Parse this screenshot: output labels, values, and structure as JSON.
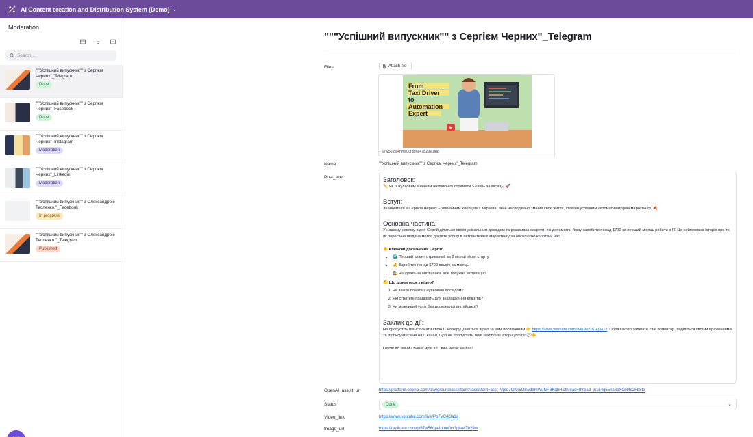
{
  "app": {
    "title": "AI Content creation and Distribution System (Demo)"
  },
  "sidebar": {
    "title": "Moderation",
    "search_placeholder": "Search...",
    "items": [
      {
        "title": "\"\"\"Успішний випускник\"\" з Сергієм Черних\"_Telegram",
        "status": "Done"
      },
      {
        "title": "\"\"\"Успішний випускник\"\" з Сергієм Черних\"_Facebook",
        "status": "Done"
      },
      {
        "title": "\"\"\"Успішний випускник\"\" з Сергієм Черних\"_Instagram",
        "status": "Moderation"
      },
      {
        "title": "\"\"\"Успішний випускник\"\" з Сергієм Черних\"_Linkedin",
        "status": "Moderation"
      },
      {
        "title": "\"\"\"Успішний випускник\"\" з Олександрою Тесленко.\"_Facebook",
        "status": "In progress"
      },
      {
        "title": "\"\"\"Успішний випускник\"\" з Олександрою Тесленко.\"_Telegram",
        "status": "Published"
      }
    ]
  },
  "record": {
    "title": "\"\"\"Успішний випускник\"\" з Сергієм Черних\"_Telegram",
    "labels": {
      "files": "Files",
      "name": "Name",
      "post_text": "Post_text",
      "openai_url": "OpenAI_assist_url",
      "status": "Status",
      "video_link": "Video_link",
      "image_url": "Image_url"
    },
    "attach_label": "Attach file",
    "file_name": "67w56fqa4hme0cr3pha47b29w.png",
    "cover_text": [
      "From",
      "Taxi Driver",
      "to",
      "Automation",
      "Expert"
    ],
    "name": "\"\"Успішний випускник\"\" з Сергієм Черних\"_Telegram",
    "post": {
      "h1": "Заголовок:",
      "p1": "✏️ Як із нульовим знанням англійської отримати $2000+ за місяць! 🚀",
      "h2": "Вступ:",
      "p2": "Знайомтеся з Сергієм Черних – звичайним хлопцем з Харкова, який несподівано змінив своє життя, ставши успішним автоматизатором маркетингу. 🍂",
      "h3": "Основна частина:",
      "p3": "У нашому новому відео Сергій ділиться своїм унікальним досвідом та розкриває секрети, які допомогли йому заробити понад $700 за перший місяць роботи в IT. Це неймовірна історія про те, як пересічна людина могла досягти успіху в автоматизації маркетингу за абсолютно короткий час!",
      "achievements_title": "🐥 Ключові досягнення Сергія:",
      "achievements": [
        "🌍 Перший клієнт отриманий за 2 місяці після старту.",
        "💰 Заробіток понад $700 всього за місяць!",
        "🕵 Не ідеальна англійська, але потужна мотивація!"
      ],
      "learn_title": "🤔 Що дізнаєтеся з відео?",
      "learn": [
        "Чи важко почати з нульовим досвідом?",
        "Які стратегії працюють для знаходження клієнтів?",
        "Чи можливий успіх без досконалої англійської?"
      ],
      "h4": "Заклик до дії:",
      "cta_before": "Не пропустіть шанс почати свою IT кар'єру! Дивіться відео за цим посиланням 👉 ",
      "cta_link": "https://www.youtube.com/live/Po7VC4j3a1s",
      "cta_after": ". Обов'язково залиште свій коментар, поділіться своїми враженнями та підписуйтеся на наш канал, щоб не пропустити нові захопливі історії успіху! 💬🐥",
      "closing": "Готові до зміни? Ваша мрія в IT вже чекає на вас!"
    },
    "openai_url": "https://platform.openai.com/playground/assistants?assistant=asst_Vpfd7GKk5O8wdbmWuNFBKqbH&thread=thread_jn154q55na6pXGR4c2Fb8te",
    "status": "Done",
    "video_link": "https://www.youtube.com/live/Po7VC4j3a1s",
    "image_url": "https://replicate.com/p/67w56fqa4hme0cr3pha47b29w"
  },
  "colors": {
    "topbar": "#6b4b9a",
    "link": "#1f5fbf",
    "fab": "#6b4bd8"
  }
}
